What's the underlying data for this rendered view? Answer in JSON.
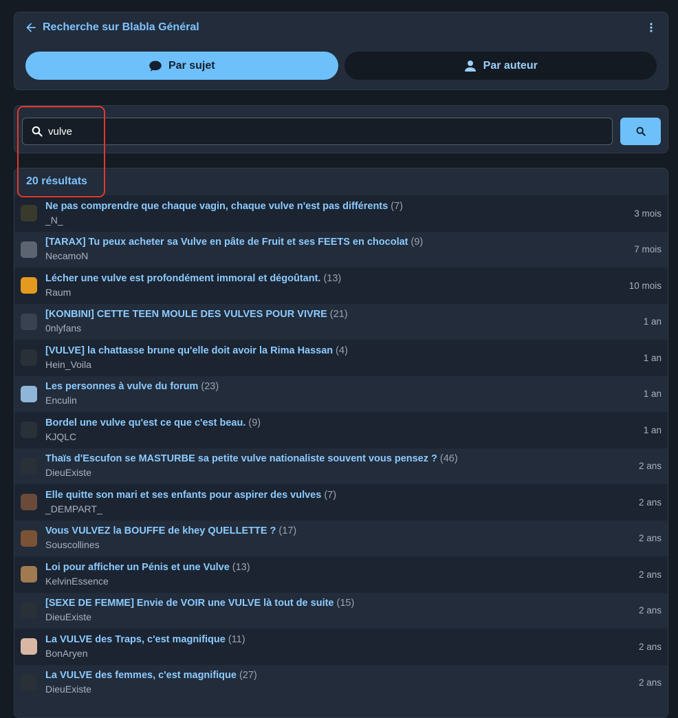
{
  "header": {
    "title": "Recherche sur Blabla Général",
    "back_icon": "arrow-left-icon",
    "menu_icon": "more-vertical-icon"
  },
  "tabs": [
    {
      "label": "Par sujet",
      "icon": "speech-bubble-icon",
      "active": true
    },
    {
      "label": "Par auteur",
      "icon": "person-icon",
      "active": false
    }
  ],
  "search": {
    "value": "vulve",
    "icon": "search-icon",
    "button_icon": "search-icon"
  },
  "results": {
    "count_label": "20 résultats",
    "items": [
      {
        "title": "Ne pas comprendre que chaque vagin, chaque vulve n'est pas différents",
        "count": "(7)",
        "author": "_N_",
        "age": "3 mois",
        "avatar_color": "#3a3a2c"
      },
      {
        "title": "[TARAX] Tu peux acheter sa Vulve en pâte de Fruit et ses FEETS en chocolat",
        "count": "(9)",
        "author": "NecamoN",
        "age": "7 mois",
        "avatar_color": "#5b6470"
      },
      {
        "title": "Lécher une vulve est profondément immoral et dégoûtant.",
        "count": "(13)",
        "author": "Raum",
        "age": "10 mois",
        "avatar_color": "#e39a1e"
      },
      {
        "title": "[KONBINI] CETTE TEEN MOULE DES VULVES POUR VIVRE",
        "count": "(21)",
        "author": "0nlyfans",
        "age": "1 an",
        "avatar_color": "#3a4250"
      },
      {
        "title": "[VULVE] la chattasse brune qu'elle doit avoir la Rima Hassan",
        "count": "(4)",
        "author": "Hein_Voila",
        "age": "1 an",
        "avatar_color": "#2a3038"
      },
      {
        "title": "Les personnes à vulve du forum",
        "count": "(23)",
        "author": "Enculin",
        "age": "1 an",
        "avatar_color": "#8fb5d8"
      },
      {
        "title": "Bordel une vulve qu'est ce que c'est beau.",
        "count": "(9)",
        "author": "KJQLC",
        "age": "1 an",
        "avatar_color": "#2a3038"
      },
      {
        "title": "Thaïs d'Escufon se MASTURBE sa petite vulve nationaliste souvent vous pensez ?",
        "count": "(46)",
        "author": "DieuExiste",
        "age": "2 ans",
        "avatar_color": "#2a3038"
      },
      {
        "title": "Elle quitte son mari et ses enfants pour aspirer des vulves",
        "count": "(7)",
        "author": "_DEMPART_",
        "age": "2 ans",
        "avatar_color": "#6b4a3a"
      },
      {
        "title": "Vous VULVEZ la BOUFFE de khey QUELLETTE ?",
        "count": "(17)",
        "author": "Souscollines",
        "age": "2 ans",
        "avatar_color": "#7a5236"
      },
      {
        "title": "Loi pour afficher un Pénis et une Vulve",
        "count": "(13)",
        "author": "KelvinEssence",
        "age": "2 ans",
        "avatar_color": "#a07a50"
      },
      {
        "title": "[SEXE DE FEMME] Envie de VOIR une VULVE là tout de suite",
        "count": "(15)",
        "author": "DieuExiste",
        "age": "2 ans",
        "avatar_color": "#2a3038"
      },
      {
        "title": "La VULVE des Traps, c'est magnifique",
        "count": "(11)",
        "author": "BonAryen",
        "age": "2 ans",
        "avatar_color": "#d9b7a4"
      },
      {
        "title": "La VULVE des femmes, c'est magnifique",
        "count": "(27)",
        "author": "DieuExiste",
        "age": "2 ans",
        "avatar_color": "#2a3038"
      }
    ]
  },
  "colors": {
    "accent": "#6ec0fb",
    "title_text": "#8ccaff",
    "highlight": "#e0392d"
  }
}
